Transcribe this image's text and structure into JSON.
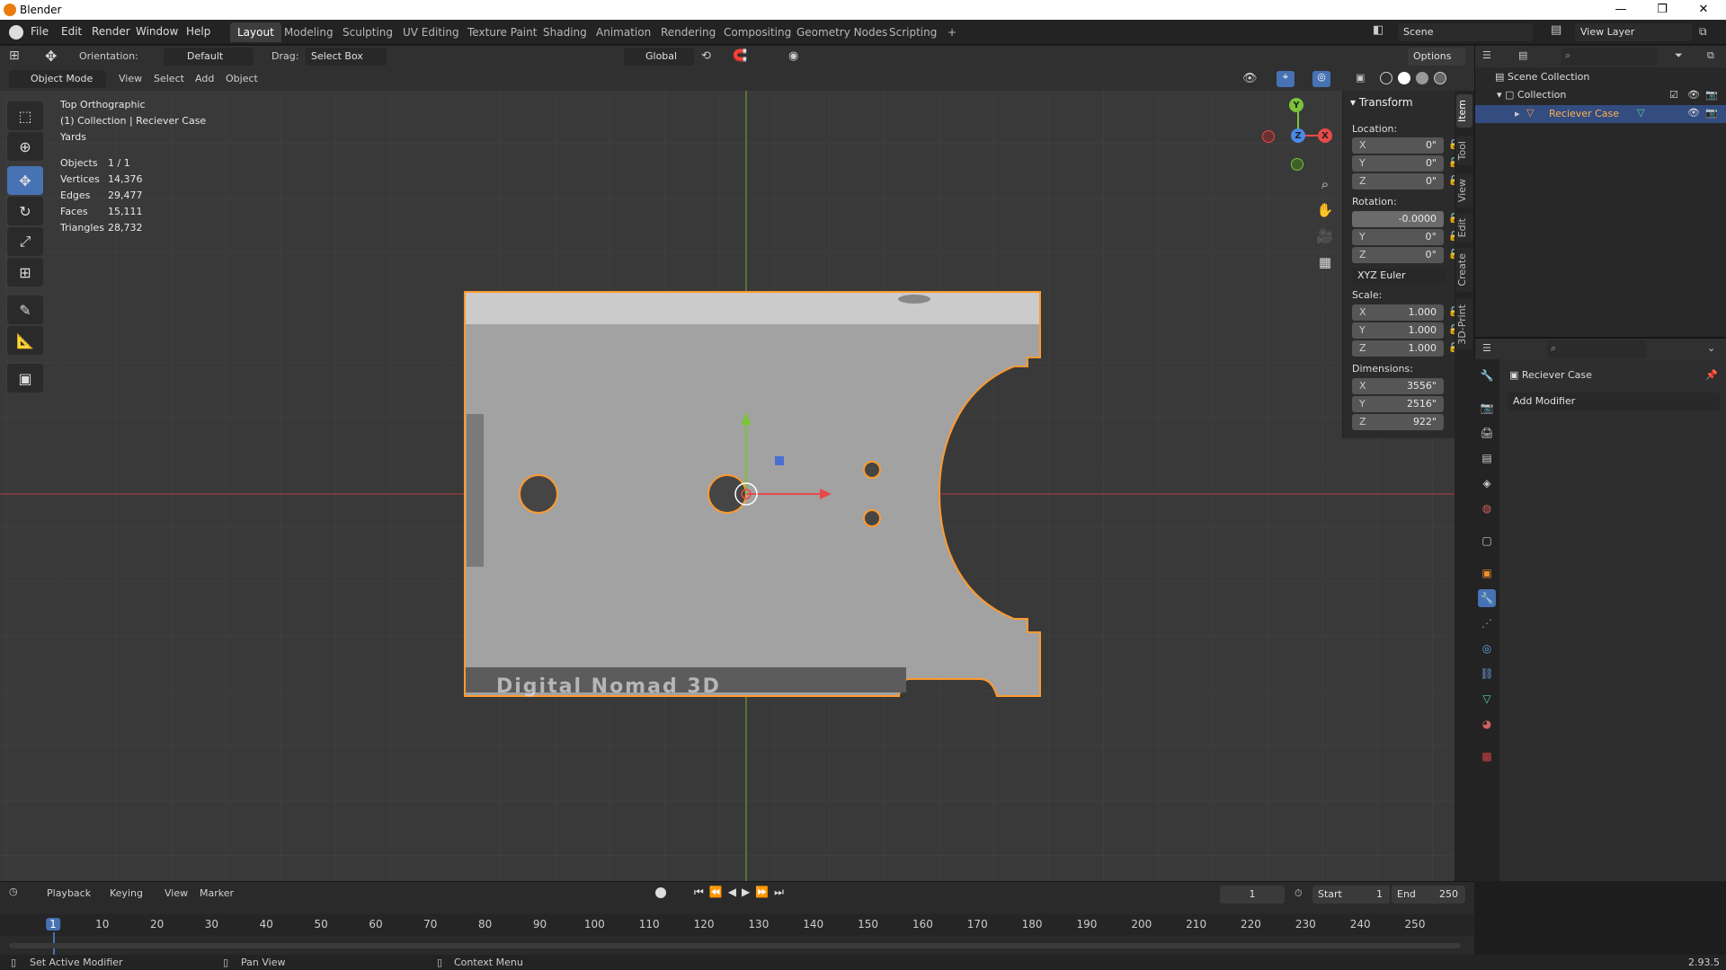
{
  "window": {
    "title": "Blender",
    "min": "—",
    "max": "❐",
    "close": "✕"
  },
  "menu": [
    "File",
    "Edit",
    "Render",
    "Window",
    "Help"
  ],
  "workspaces": [
    "Layout",
    "Modeling",
    "Sculpting",
    "UV Editing",
    "Texture Paint",
    "Shading",
    "Animation",
    "Rendering",
    "Compositing",
    "Geometry Nodes",
    "Scripting",
    "+"
  ],
  "active_workspace": "Layout",
  "scene": {
    "label": "Scene",
    "view_layer": "View Layer"
  },
  "header": {
    "orientation_label": "Orientation:",
    "orientation_value": "Default",
    "drag_label": "Drag:",
    "drag_value": "Select Box",
    "transform_orientation": "Global",
    "options": "Options"
  },
  "viewport_header": {
    "mode": "Object Mode",
    "menus": [
      "View",
      "Select",
      "Add",
      "Object"
    ]
  },
  "overlay": {
    "view_name": "Top Orthographic",
    "collection": "(1) Collection | Reciever Case",
    "units": "Yards",
    "stats": [
      {
        "label": "Objects",
        "value": "1 / 1"
      },
      {
        "label": "Vertices",
        "value": "14,376"
      },
      {
        "label": "Edges",
        "value": "29,477"
      },
      {
        "label": "Faces",
        "value": "15,111"
      },
      {
        "label": "Triangles",
        "value": "28,732"
      }
    ],
    "engraved_text": "Digital Nomad 3D"
  },
  "gizmo": {
    "x": "X",
    "y": "Y",
    "z": "Z"
  },
  "npanel": {
    "title": "Transform",
    "location_label": "Location:",
    "location": [
      {
        "axis": "X",
        "value": "0\""
      },
      {
        "axis": "Y",
        "value": "0\""
      },
      {
        "axis": "Z",
        "value": "0\""
      }
    ],
    "rotation_label": "Rotation:",
    "rotation": [
      {
        "axis": "",
        "value": "-0.0000"
      },
      {
        "axis": "Y",
        "value": "0°"
      },
      {
        "axis": "Z",
        "value": "0°"
      }
    ],
    "rotation_mode": "XYZ Euler",
    "scale_label": "Scale:",
    "scale": [
      {
        "axis": "X",
        "value": "1.000"
      },
      {
        "axis": "Y",
        "value": "1.000"
      },
      {
        "axis": "Z",
        "value": "1.000"
      }
    ],
    "dimensions_label": "Dimensions:",
    "dimensions": [
      {
        "axis": "X",
        "value": "3556\""
      },
      {
        "axis": "Y",
        "value": "2516\""
      },
      {
        "axis": "Z",
        "value": "922\""
      }
    ]
  },
  "side_tabs": [
    "Item",
    "Tool",
    "View",
    "Edit",
    "Create",
    "3D-Print"
  ],
  "outliner": {
    "scene_collection": "Scene Collection",
    "collection": "Collection",
    "object": "Reciever Case"
  },
  "properties": {
    "object_name": "Reciever Case",
    "add_modifier": "Add Modifier"
  },
  "timeline": {
    "menus": [
      "Playback",
      "Keying",
      "View",
      "Marker"
    ],
    "current_frame": "1",
    "start_label": "Start",
    "start": "1",
    "end_label": "End",
    "end": "250",
    "ticks": [
      "1",
      "10",
      "20",
      "30",
      "40",
      "50",
      "60",
      "70",
      "80",
      "90",
      "100",
      "110",
      "120",
      "130",
      "140",
      "150",
      "160",
      "170",
      "180",
      "190",
      "200",
      "210",
      "220",
      "230",
      "240",
      "250"
    ]
  },
  "status": {
    "left": "Set Active Modifier",
    "middle": "Pan View",
    "right": "Context Menu",
    "version": "2.93.5"
  }
}
